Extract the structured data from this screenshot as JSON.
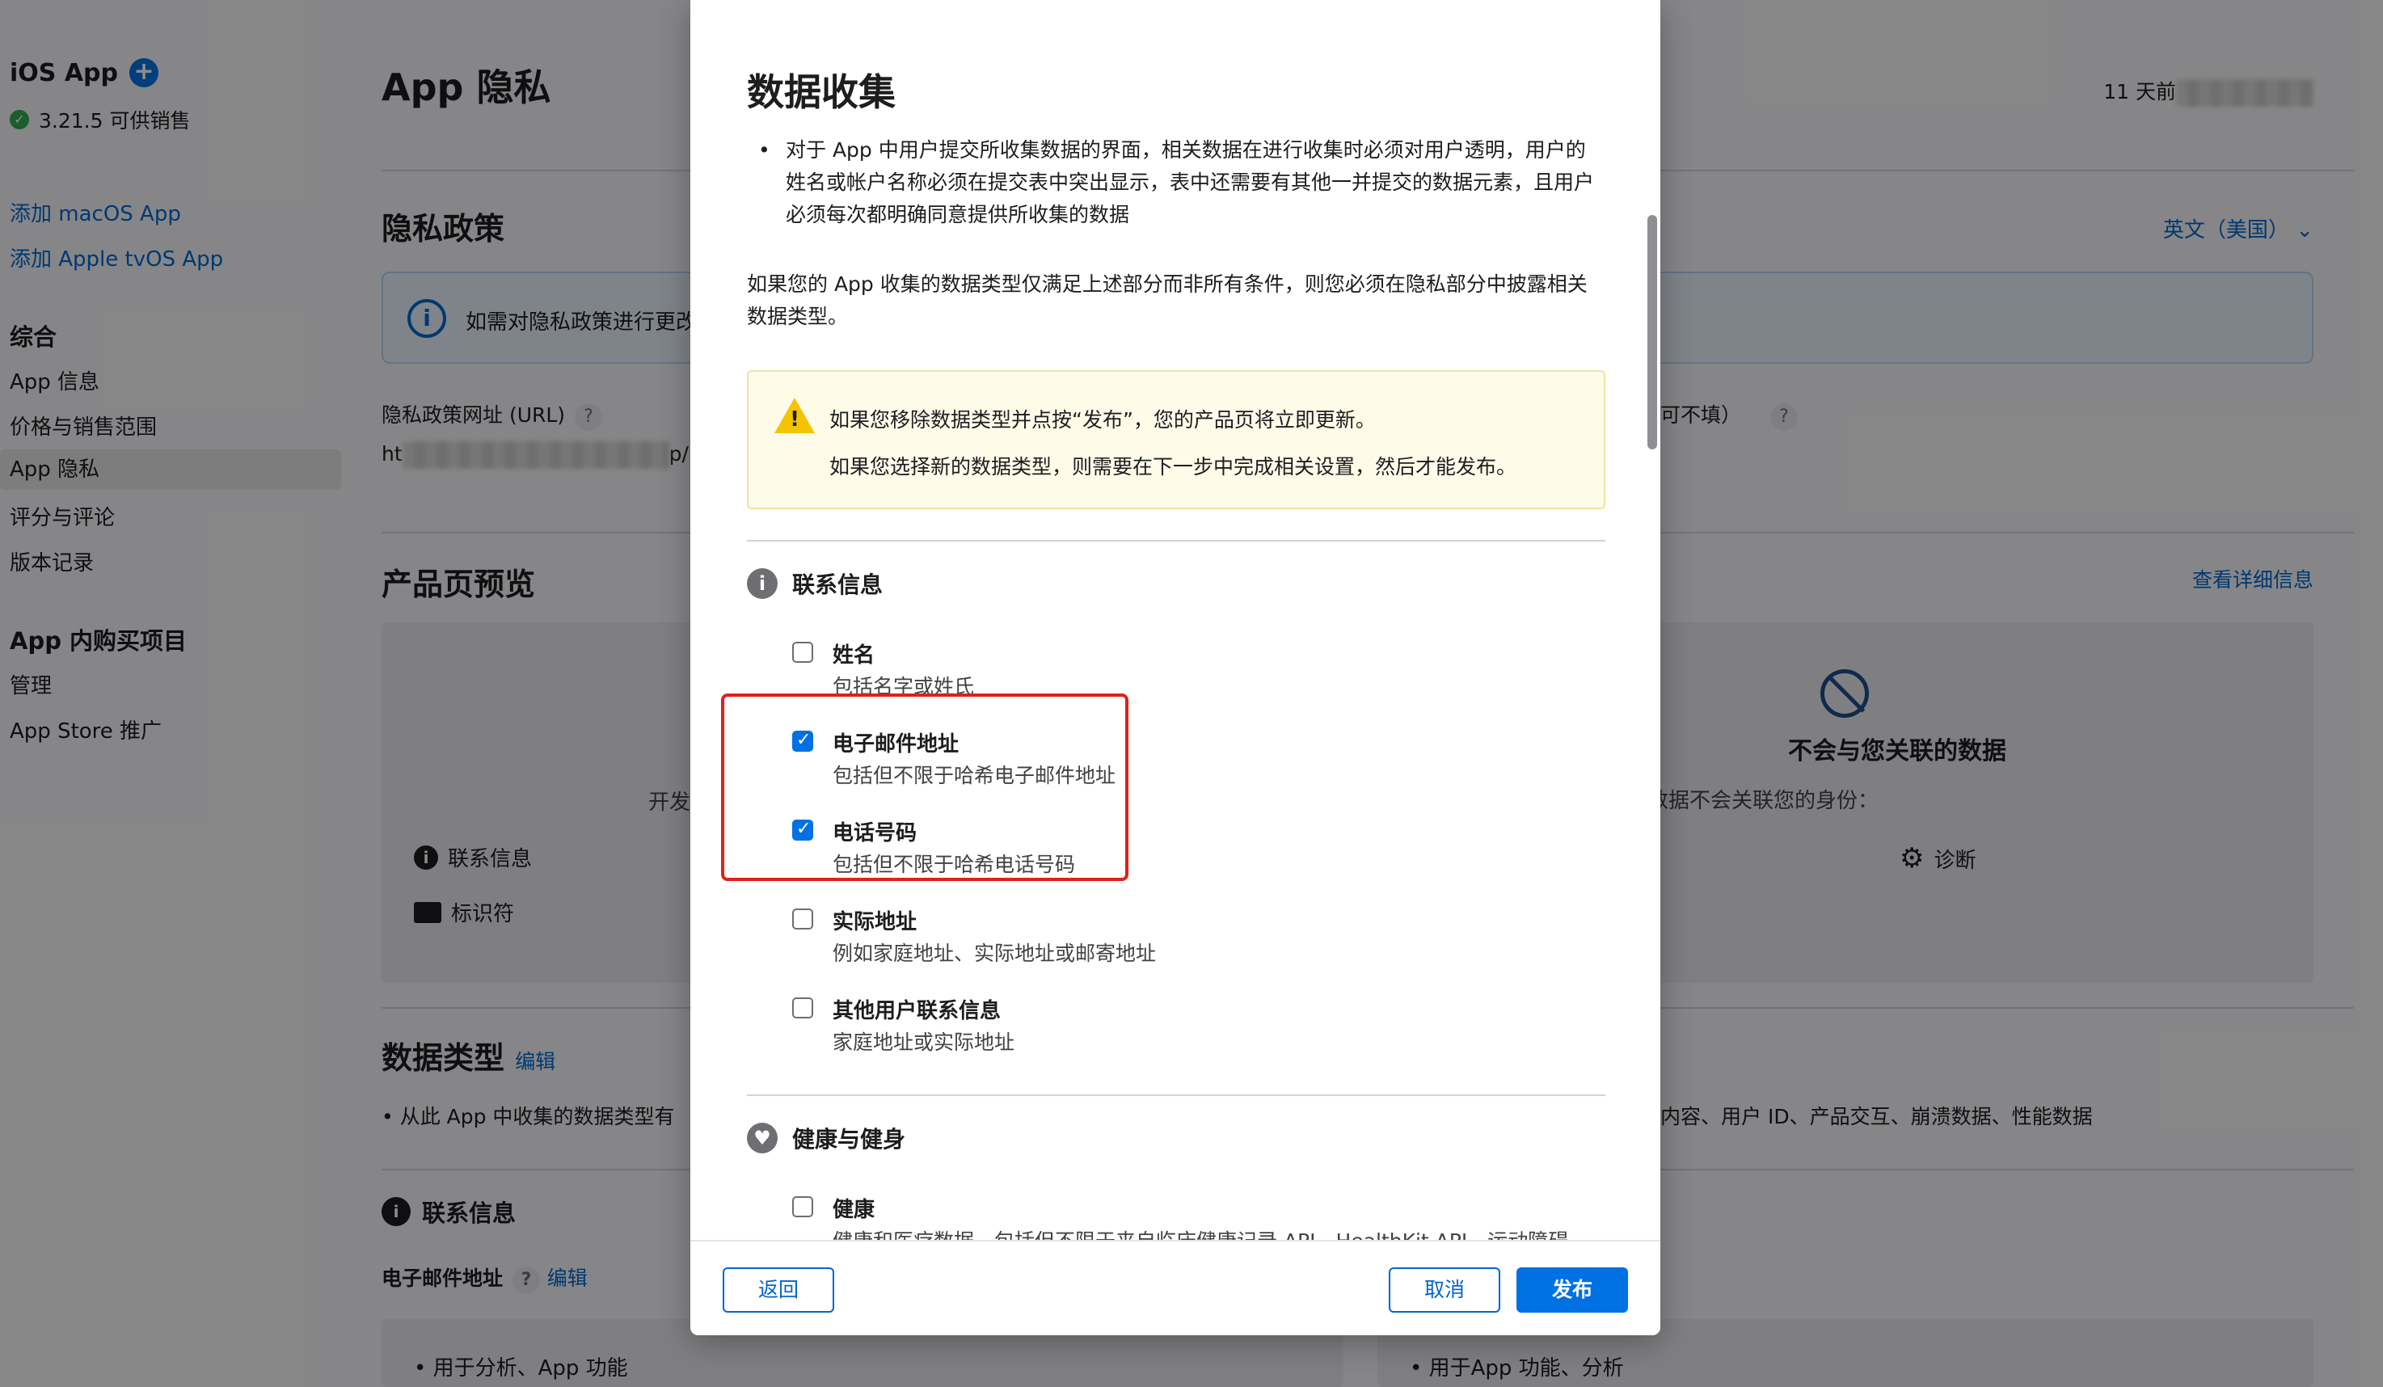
{
  "sidebar": {
    "app_title": "iOS App",
    "version": "3.21.5 可供销售",
    "add_macos": "添加 macOS App",
    "add_tvos": "添加 Apple tvOS App",
    "general_heading": "综合",
    "items": [
      "App 信息",
      "价格与销售范围",
      "App 隐私",
      "评分与评论",
      "版本记录"
    ],
    "iap_heading": "App 内购买项目",
    "iap_items": [
      "管理",
      "App Store 推广"
    ]
  },
  "main": {
    "title": "App 隐私",
    "updated": "11 天前",
    "privacy_policy_title": "隐私政策",
    "language": "英文（美国）",
    "banner_text": "如需对隐私政策进行更改",
    "url_label": "隐私政策网址 (URL)",
    "url_value_prefix": "ht",
    "url_value_suffix": "p/",
    "optional_label": "可不填）",
    "preview_title": "产品页预览",
    "view_details": "查看详细信息",
    "developer_partial": "开发",
    "left_card_items": [
      "联系信息",
      "标识符"
    ],
    "not_linked_title": "不会与您关联的数据",
    "not_linked_sub": "发者可能会收集以下数据，但数据不会关联您的身份：",
    "diagnostics": "诊断",
    "data_types_title": "数据类型",
    "edit": "编辑",
    "data_types_bullet": "从此 App 中收集的数据类型有",
    "data_types_bullet_right": "内容、用户 ID、产品交互、崩溃数据、性能数据",
    "contact_heading": "联系信息",
    "email_label": "电子邮件地址",
    "bottom_left_bullet": "用于分析、App 功能",
    "bottom_right_bullet": "用于App 功能、分析"
  },
  "modal": {
    "title": "数据收集",
    "bullet": "对于 App 中用户提交所收集数据的界面，相关数据在进行收集时必须对用户透明，用户的姓名或帐户名称必须在提交表中突出显示，表中还需要有其他一并提交的数据元素，且用户必须每次都明确同意提供所收集的数据",
    "para": "如果您的 App 收集的数据类型仅满足上述部分而非所有条件，则您必须在隐私部分中披露相关数据类型。",
    "warning_line1": "如果您移除数据类型并点按“发布”，您的产品页将立即更新。",
    "warning_line2": "如果您选择新的数据类型，则需要在下一步中完成相关设置，然后才能发布。",
    "contact_category": "联系信息",
    "options": [
      {
        "label": "姓名",
        "desc": "包括名字或姓氏",
        "checked": false
      },
      {
        "label": "电子邮件地址",
        "desc": "包括但不限于哈希电子邮件地址",
        "checked": true
      },
      {
        "label": "电话号码",
        "desc": "包括但不限于哈希电话号码",
        "checked": true
      },
      {
        "label": "实际地址",
        "desc": "例如家庭地址、实际地址或邮寄地址",
        "checked": false
      },
      {
        "label": "其他用户联系信息",
        "desc": "家庭地址或实际地址",
        "checked": false
      }
    ],
    "health_category": "健康与健身",
    "health_option": {
      "label": "健康",
      "desc": "健康和医疗数据，包括但不限于来自临床健康记录 API、HealthKit API、运动障碍",
      "checked": false
    },
    "back": "返回",
    "cancel": "取消",
    "publish": "发布"
  },
  "colors": {
    "accent": "#0071e3",
    "highlight_box": "#e0201c",
    "warning_bg": "#fffbe9"
  }
}
